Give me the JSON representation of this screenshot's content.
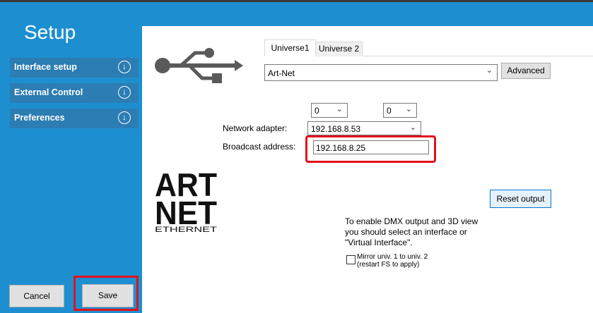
{
  "sidebar": {
    "title": "Setup",
    "items": [
      {
        "label": "Interface setup"
      },
      {
        "label": "External Control"
      },
      {
        "label": "Preferences"
      }
    ],
    "cancel_label": "Cancel",
    "save_label": "Save"
  },
  "tabs": [
    {
      "label": "Universe1",
      "selected": true
    },
    {
      "label": "Universe 2",
      "selected": false
    }
  ],
  "protocol": {
    "value": "Art-Net"
  },
  "advanced_label": "Advanced",
  "selectors": [
    {
      "value": "0"
    },
    {
      "value": "0"
    }
  ],
  "network_adapter": {
    "label": "Network adapter:",
    "value": "192.168.8.53"
  },
  "broadcast_address": {
    "label": "Broadcast address:",
    "value": "192.168.8.25"
  },
  "reset_label": "Reset output",
  "info_lines": [
    "To enable DMX output and 3D view",
    "you should select an interface or",
    "\"Virtual Interface\"."
  ],
  "mirror": {
    "line1": "Mirror univ. 1 to univ. 2",
    "line2": "(restart FS to apply)",
    "checked": false
  },
  "logo": {
    "line1": "ART",
    "line2": "NET",
    "line3": "ETHERNET"
  },
  "icons": {
    "usb": "usb-icon",
    "expand": "chevron-down-circle-icon",
    "dropdown": "chevron-down-icon"
  },
  "colors": {
    "sidebar": "#1d8fd0",
    "sidebar_item": "#2b7db3",
    "highlight": "#e2111b",
    "accent_button_border": "#0078d7"
  }
}
